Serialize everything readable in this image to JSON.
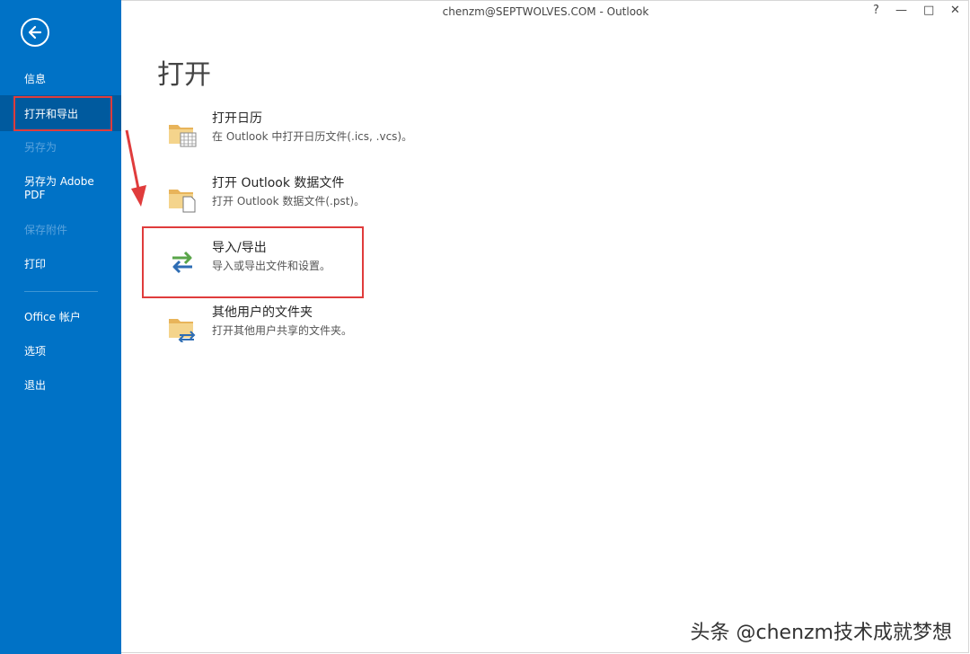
{
  "window": {
    "title": "chenzm@SEPTWOLVES.COM - Outlook",
    "help_glyph": "?",
    "minimize_glyph": "—",
    "maximize_glyph": "□",
    "close_glyph": "✕"
  },
  "sidebar": {
    "items": [
      {
        "label": "信息"
      },
      {
        "label": "打开和导出"
      },
      {
        "label": "另存为"
      },
      {
        "label": "另存为 Adobe PDF"
      },
      {
        "label": "保存附件"
      },
      {
        "label": "打印"
      },
      {
        "label": "Office 帐户"
      },
      {
        "label": "选项"
      },
      {
        "label": "退出"
      }
    ]
  },
  "main": {
    "title": "打开",
    "options": [
      {
        "title": "打开日历",
        "desc": "在 Outlook 中打开日历文件(.ics, .vcs)。",
        "icon": "folder-calendar-icon"
      },
      {
        "title": "打开 Outlook 数据文件",
        "desc": "打开 Outlook 数据文件(.pst)。",
        "icon": "folder-file-icon"
      },
      {
        "title": "导入/导出",
        "desc": "导入或导出文件和设置。",
        "icon": "import-export-arrows-icon"
      },
      {
        "title": "其他用户的文件夹",
        "desc": "打开其他用户共享的文件夹。",
        "icon": "folder-share-icon"
      }
    ]
  },
  "watermark": "头条 @chenzm技术成就梦想",
  "colors": {
    "sidebar_bg": "#0072c6",
    "highlight_red": "#e03c3c"
  }
}
